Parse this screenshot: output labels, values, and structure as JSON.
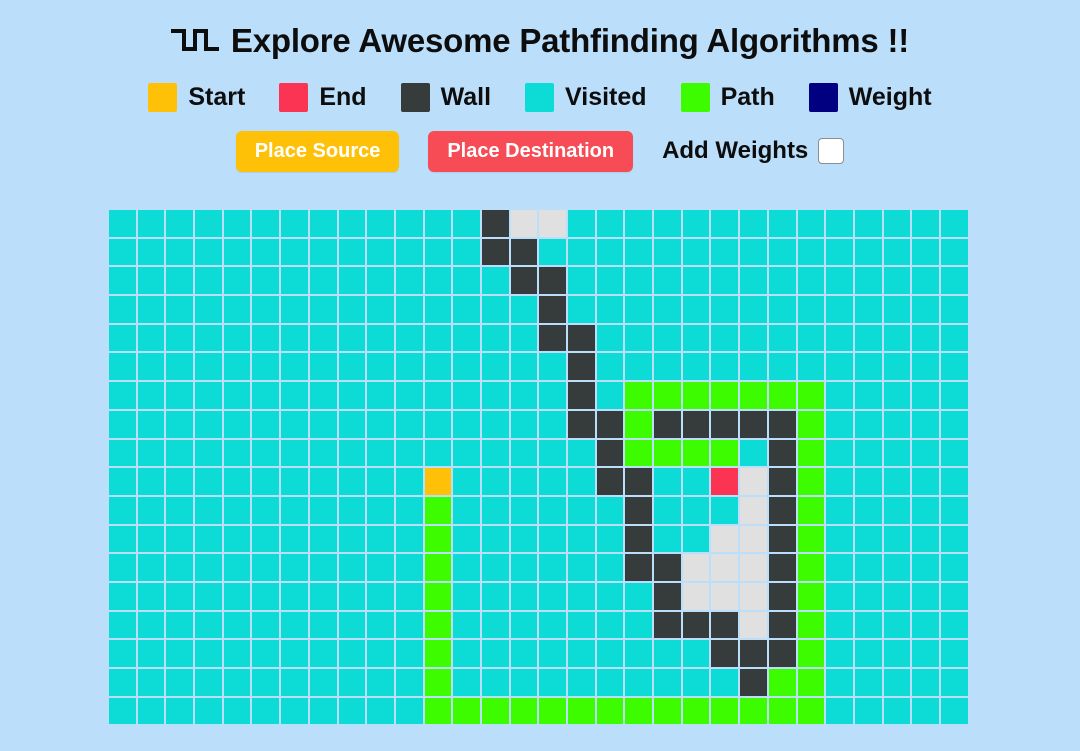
{
  "header": {
    "icon": "pathfinding-route-icon",
    "title": "Explore Awesome Pathfinding Algorithms !!"
  },
  "legend": {
    "items": [
      {
        "label": "Start",
        "color": "#ffc107",
        "key": "start"
      },
      {
        "label": "End",
        "color": "#fb3453",
        "key": "end"
      },
      {
        "label": "Wall",
        "color": "#363b3b",
        "key": "wall"
      },
      {
        "label": "Visited",
        "color": "#0ddcd6",
        "key": "visited"
      },
      {
        "label": "Path",
        "color": "#3dfc00",
        "key": "path"
      },
      {
        "label": "Weight",
        "color": "#000080",
        "key": "weight"
      }
    ]
  },
  "controls": {
    "place_source_label": "Place Source",
    "place_source_color": "#ffc107",
    "place_destination_label": "Place Destination",
    "place_destination_color": "#f74c55",
    "add_weights_label": "Add Weights",
    "add_weights_checked": false
  },
  "grid": {
    "rows": 18,
    "cols": 30,
    "cell_size": 26.7,
    "gap": 2,
    "background": "#bbdefb",
    "legend_keys": [
      "visited",
      "unvisited",
      "wall",
      "path",
      "start",
      "end",
      "weight"
    ],
    "start_cell": {
      "row": 9,
      "col": 11
    },
    "end_cell": {
      "row": 9,
      "col": 21
    },
    "cells": [
      [
        "visited",
        "visited",
        "visited",
        "visited",
        "visited",
        "visited",
        "visited",
        "visited",
        "visited",
        "visited",
        "visited",
        "visited",
        "visited",
        "wall",
        "unvisited",
        "unvisited",
        "visited",
        "visited",
        "visited",
        "visited",
        "visited",
        "visited",
        "visited",
        "visited",
        "visited",
        "visited",
        "visited",
        "visited",
        "visited",
        "visited"
      ],
      [
        "visited",
        "visited",
        "visited",
        "visited",
        "visited",
        "visited",
        "visited",
        "visited",
        "visited",
        "visited",
        "visited",
        "visited",
        "visited",
        "wall",
        "wall",
        "visited",
        "visited",
        "visited",
        "visited",
        "visited",
        "visited",
        "visited",
        "visited",
        "visited",
        "visited",
        "visited",
        "visited",
        "visited",
        "visited",
        "visited"
      ],
      [
        "visited",
        "visited",
        "visited",
        "visited",
        "visited",
        "visited",
        "visited",
        "visited",
        "visited",
        "visited",
        "visited",
        "visited",
        "visited",
        "visited",
        "wall",
        "wall",
        "visited",
        "visited",
        "visited",
        "visited",
        "visited",
        "visited",
        "visited",
        "visited",
        "visited",
        "visited",
        "visited",
        "visited",
        "visited",
        "visited"
      ],
      [
        "visited",
        "visited",
        "visited",
        "visited",
        "visited",
        "visited",
        "visited",
        "visited",
        "visited",
        "visited",
        "visited",
        "visited",
        "visited",
        "visited",
        "visited",
        "wall",
        "visited",
        "visited",
        "visited",
        "visited",
        "visited",
        "visited",
        "visited",
        "visited",
        "visited",
        "visited",
        "visited",
        "visited",
        "visited",
        "visited"
      ],
      [
        "visited",
        "visited",
        "visited",
        "visited",
        "visited",
        "visited",
        "visited",
        "visited",
        "visited",
        "visited",
        "visited",
        "visited",
        "visited",
        "visited",
        "visited",
        "wall",
        "wall",
        "visited",
        "visited",
        "visited",
        "visited",
        "visited",
        "visited",
        "visited",
        "visited",
        "visited",
        "visited",
        "visited",
        "visited",
        "visited"
      ],
      [
        "visited",
        "visited",
        "visited",
        "visited",
        "visited",
        "visited",
        "visited",
        "visited",
        "visited",
        "visited",
        "visited",
        "visited",
        "visited",
        "visited",
        "visited",
        "visited",
        "wall",
        "visited",
        "visited",
        "visited",
        "visited",
        "visited",
        "visited",
        "visited",
        "visited",
        "visited",
        "visited",
        "visited",
        "visited",
        "visited"
      ],
      [
        "visited",
        "visited",
        "visited",
        "visited",
        "visited",
        "visited",
        "visited",
        "visited",
        "visited",
        "visited",
        "visited",
        "visited",
        "visited",
        "visited",
        "visited",
        "visited",
        "wall",
        "visited",
        "path",
        "path",
        "path",
        "path",
        "path",
        "path",
        "path",
        "visited",
        "visited",
        "visited",
        "visited",
        "visited"
      ],
      [
        "visited",
        "visited",
        "visited",
        "visited",
        "visited",
        "visited",
        "visited",
        "visited",
        "visited",
        "visited",
        "visited",
        "visited",
        "visited",
        "visited",
        "visited",
        "visited",
        "wall",
        "wall",
        "path",
        "wall",
        "wall",
        "wall",
        "wall",
        "wall",
        "path",
        "visited",
        "visited",
        "visited",
        "visited",
        "visited"
      ],
      [
        "visited",
        "visited",
        "visited",
        "visited",
        "visited",
        "visited",
        "visited",
        "visited",
        "visited",
        "visited",
        "visited",
        "visited",
        "visited",
        "visited",
        "visited",
        "visited",
        "visited",
        "wall",
        "path",
        "path",
        "path",
        "path",
        "visited",
        "wall",
        "path",
        "visited",
        "visited",
        "visited",
        "visited",
        "visited"
      ],
      [
        "visited",
        "visited",
        "visited",
        "visited",
        "visited",
        "visited",
        "visited",
        "visited",
        "visited",
        "visited",
        "visited",
        "start",
        "visited",
        "visited",
        "visited",
        "visited",
        "visited",
        "wall",
        "wall",
        "visited",
        "visited",
        "end",
        "unvisited",
        "wall",
        "path",
        "visited",
        "visited",
        "visited",
        "visited",
        "visited"
      ],
      [
        "visited",
        "visited",
        "visited",
        "visited",
        "visited",
        "visited",
        "visited",
        "visited",
        "visited",
        "visited",
        "visited",
        "path",
        "visited",
        "visited",
        "visited",
        "visited",
        "visited",
        "visited",
        "wall",
        "visited",
        "visited",
        "visited",
        "unvisited",
        "wall",
        "path",
        "visited",
        "visited",
        "visited",
        "visited",
        "visited"
      ],
      [
        "visited",
        "visited",
        "visited",
        "visited",
        "visited",
        "visited",
        "visited",
        "visited",
        "visited",
        "visited",
        "visited",
        "path",
        "visited",
        "visited",
        "visited",
        "visited",
        "visited",
        "visited",
        "wall",
        "visited",
        "visited",
        "unvisited",
        "unvisited",
        "wall",
        "path",
        "visited",
        "visited",
        "visited",
        "visited",
        "visited"
      ],
      [
        "visited",
        "visited",
        "visited",
        "visited",
        "visited",
        "visited",
        "visited",
        "visited",
        "visited",
        "visited",
        "visited",
        "path",
        "visited",
        "visited",
        "visited",
        "visited",
        "visited",
        "visited",
        "wall",
        "wall",
        "unvisited",
        "unvisited",
        "unvisited",
        "wall",
        "path",
        "visited",
        "visited",
        "visited",
        "visited",
        "visited"
      ],
      [
        "visited",
        "visited",
        "visited",
        "visited",
        "visited",
        "visited",
        "visited",
        "visited",
        "visited",
        "visited",
        "visited",
        "path",
        "visited",
        "visited",
        "visited",
        "visited",
        "visited",
        "visited",
        "visited",
        "wall",
        "unvisited",
        "unvisited",
        "unvisited",
        "wall",
        "path",
        "visited",
        "visited",
        "visited",
        "visited",
        "visited"
      ],
      [
        "visited",
        "visited",
        "visited",
        "visited",
        "visited",
        "visited",
        "visited",
        "visited",
        "visited",
        "visited",
        "visited",
        "path",
        "visited",
        "visited",
        "visited",
        "visited",
        "visited",
        "visited",
        "visited",
        "wall",
        "wall",
        "wall",
        "unvisited",
        "wall",
        "path",
        "visited",
        "visited",
        "visited",
        "visited",
        "visited"
      ],
      [
        "visited",
        "visited",
        "visited",
        "visited",
        "visited",
        "visited",
        "visited",
        "visited",
        "visited",
        "visited",
        "visited",
        "path",
        "visited",
        "visited",
        "visited",
        "visited",
        "visited",
        "visited",
        "visited",
        "visited",
        "visited",
        "wall",
        "wall",
        "wall",
        "path",
        "visited",
        "visited",
        "visited",
        "visited",
        "visited"
      ],
      [
        "visited",
        "visited",
        "visited",
        "visited",
        "visited",
        "visited",
        "visited",
        "visited",
        "visited",
        "visited",
        "visited",
        "path",
        "visited",
        "visited",
        "visited",
        "visited",
        "visited",
        "visited",
        "visited",
        "visited",
        "visited",
        "visited",
        "wall",
        "path",
        "path",
        "visited",
        "visited",
        "visited",
        "visited",
        "visited"
      ],
      [
        "visited",
        "visited",
        "visited",
        "visited",
        "visited",
        "visited",
        "visited",
        "visited",
        "visited",
        "visited",
        "visited",
        "path",
        "path",
        "path",
        "path",
        "path",
        "path",
        "path",
        "path",
        "path",
        "path",
        "path",
        "path",
        "path",
        "path",
        "visited",
        "visited",
        "visited",
        "visited",
        "visited"
      ]
    ]
  }
}
